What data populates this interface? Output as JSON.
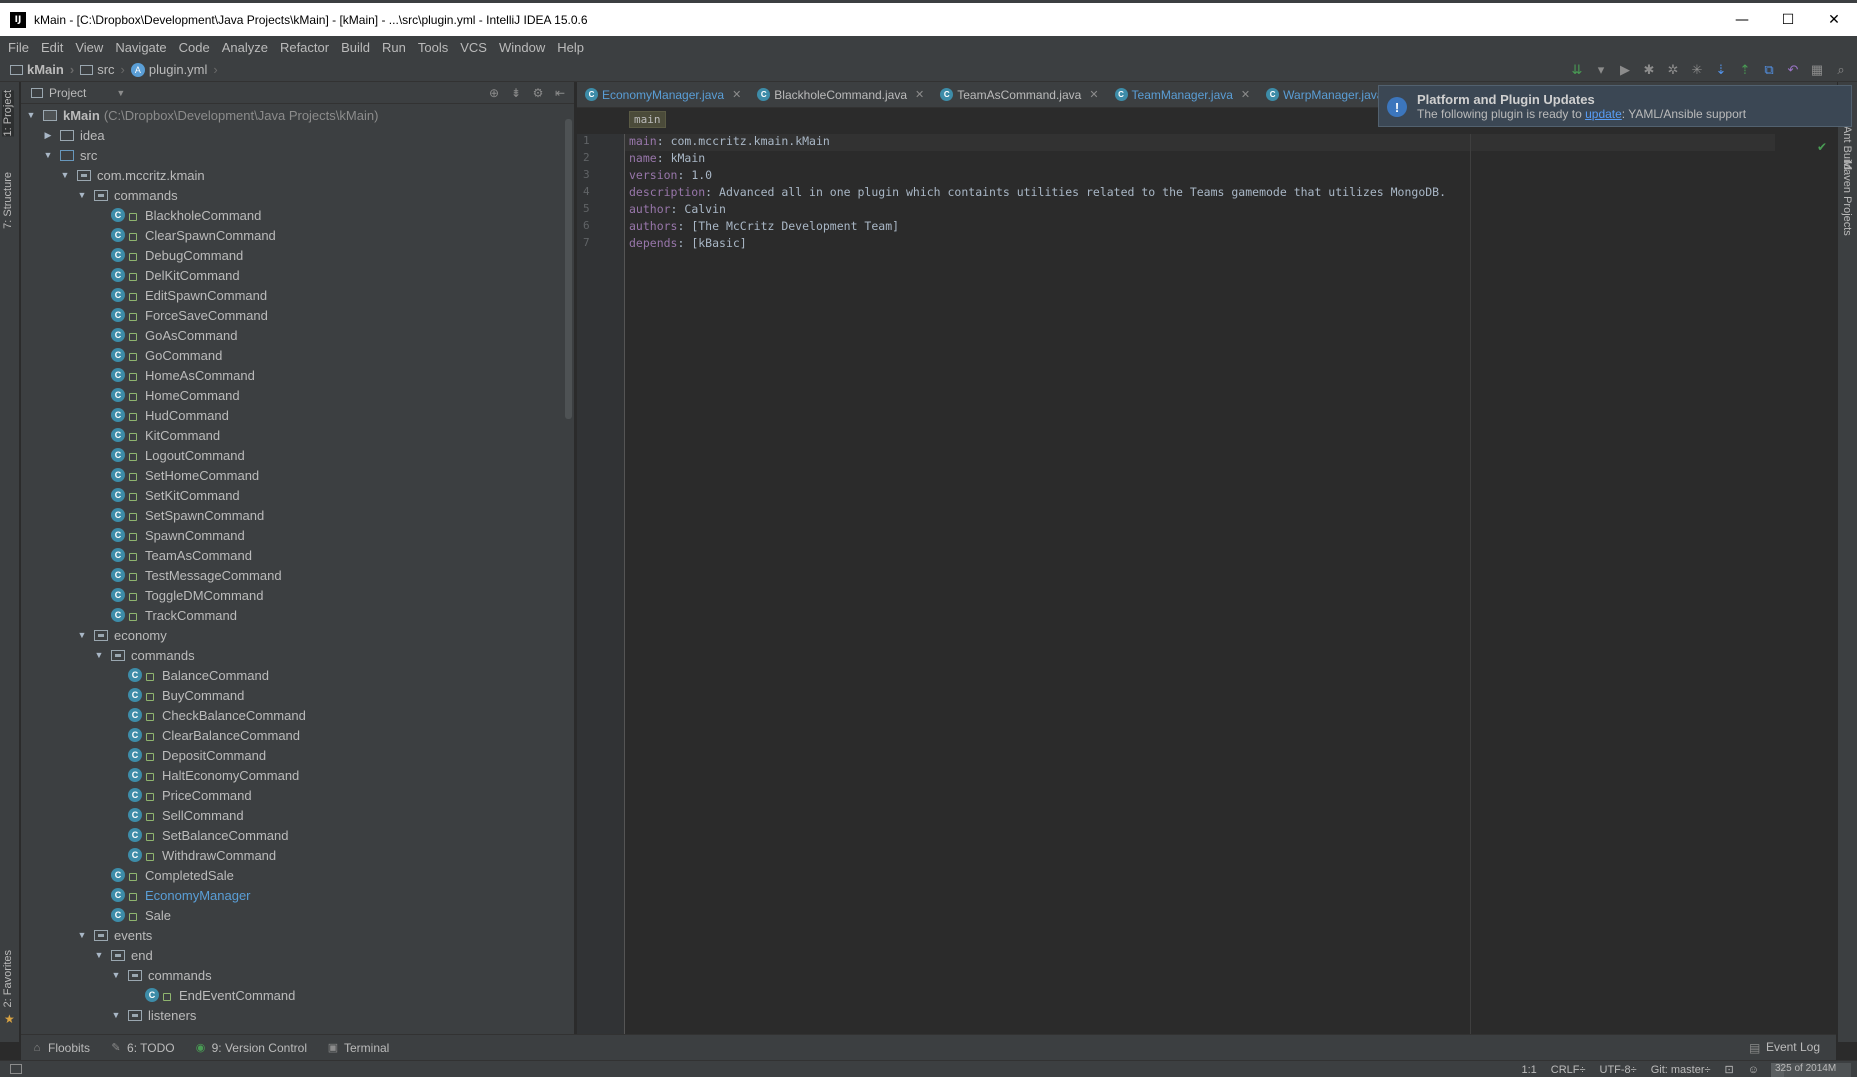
{
  "window": {
    "title": "kMain - [C:\\Dropbox\\Development\\Java Projects\\kMain] - [kMain] - ...\\src\\plugin.yml - IntelliJ IDEA 15.0.6",
    "app_icon": "IJ",
    "minimize": "—",
    "maximize": "☐",
    "close": "✕"
  },
  "menu": [
    "File",
    "Edit",
    "View",
    "Navigate",
    "Code",
    "Analyze",
    "Refactor",
    "Build",
    "Run",
    "Tools",
    "VCS",
    "Window",
    "Help"
  ],
  "navbar": {
    "crumbs": [
      "kMain",
      "src",
      "plugin.yml"
    ]
  },
  "left_strip": {
    "project_tab": "1: Project",
    "structure_tab": "7: Structure",
    "favorites_tab": "2: Favorites"
  },
  "right_strip": {
    "build_tab": "Ant Build",
    "maven_tab": "Maven Projects"
  },
  "project_panel": {
    "header": "Project",
    "root_label": "kMain",
    "root_path": "(C:\\Dropbox\\Development\\Java Projects\\kMain)",
    "items": [
      {
        "depth": 1,
        "type": "folder",
        "label": "idea",
        "expanded": false
      },
      {
        "depth": 1,
        "type": "src",
        "label": "src",
        "expanded": true
      },
      {
        "depth": 2,
        "type": "pkg",
        "label": "com.mccritz.kmain",
        "expanded": true
      },
      {
        "depth": 3,
        "type": "pkg",
        "label": "commands",
        "expanded": true
      },
      {
        "depth": 4,
        "type": "class",
        "label": "BlackholeCommand"
      },
      {
        "depth": 4,
        "type": "class",
        "label": "ClearSpawnCommand"
      },
      {
        "depth": 4,
        "type": "class",
        "label": "DebugCommand"
      },
      {
        "depth": 4,
        "type": "class",
        "label": "DelKitCommand"
      },
      {
        "depth": 4,
        "type": "class",
        "label": "EditSpawnCommand"
      },
      {
        "depth": 4,
        "type": "class",
        "label": "ForceSaveCommand"
      },
      {
        "depth": 4,
        "type": "class",
        "label": "GoAsCommand"
      },
      {
        "depth": 4,
        "type": "class",
        "label": "GoCommand"
      },
      {
        "depth": 4,
        "type": "class",
        "label": "HomeAsCommand"
      },
      {
        "depth": 4,
        "type": "class",
        "label": "HomeCommand"
      },
      {
        "depth": 4,
        "type": "class",
        "label": "HudCommand"
      },
      {
        "depth": 4,
        "type": "class",
        "label": "KitCommand"
      },
      {
        "depth": 4,
        "type": "class",
        "label": "LogoutCommand"
      },
      {
        "depth": 4,
        "type": "class",
        "label": "SetHomeCommand"
      },
      {
        "depth": 4,
        "type": "class",
        "label": "SetKitCommand"
      },
      {
        "depth": 4,
        "type": "class",
        "label": "SetSpawnCommand"
      },
      {
        "depth": 4,
        "type": "class",
        "label": "SpawnCommand"
      },
      {
        "depth": 4,
        "type": "class",
        "label": "TeamAsCommand"
      },
      {
        "depth": 4,
        "type": "class",
        "label": "TestMessageCommand"
      },
      {
        "depth": 4,
        "type": "class",
        "label": "ToggleDMCommand"
      },
      {
        "depth": 4,
        "type": "class",
        "label": "TrackCommand"
      },
      {
        "depth": 3,
        "type": "pkg",
        "label": "economy",
        "expanded": true
      },
      {
        "depth": 4,
        "type": "pkg",
        "label": "commands",
        "expanded": true
      },
      {
        "depth": 5,
        "type": "class",
        "label": "BalanceCommand"
      },
      {
        "depth": 5,
        "type": "class",
        "label": "BuyCommand"
      },
      {
        "depth": 5,
        "type": "class",
        "label": "CheckBalanceCommand"
      },
      {
        "depth": 5,
        "type": "class",
        "label": "ClearBalanceCommand"
      },
      {
        "depth": 5,
        "type": "class",
        "label": "DepositCommand"
      },
      {
        "depth": 5,
        "type": "class",
        "label": "HaltEconomyCommand"
      },
      {
        "depth": 5,
        "type": "class",
        "label": "PriceCommand"
      },
      {
        "depth": 5,
        "type": "class",
        "label": "SellCommand"
      },
      {
        "depth": 5,
        "type": "class",
        "label": "SetBalanceCommand"
      },
      {
        "depth": 5,
        "type": "class",
        "label": "WithdrawCommand"
      },
      {
        "depth": 4,
        "type": "class",
        "label": "CompletedSale"
      },
      {
        "depth": 4,
        "type": "class",
        "label": "EconomyManager",
        "highlight": true
      },
      {
        "depth": 4,
        "type": "class",
        "label": "Sale"
      },
      {
        "depth": 3,
        "type": "pkg",
        "label": "events",
        "expanded": true
      },
      {
        "depth": 4,
        "type": "pkg",
        "label": "end",
        "expanded": true
      },
      {
        "depth": 5,
        "type": "pkg",
        "label": "commands",
        "expanded": true
      },
      {
        "depth": 6,
        "type": "class",
        "label": "EndEventCommand"
      },
      {
        "depth": 5,
        "type": "pkg",
        "label": "listeners",
        "expanded": true
      }
    ]
  },
  "editor": {
    "tabs": [
      {
        "label": "EconomyManager.java",
        "highlight": true
      },
      {
        "label": "BlackholeCommand.java",
        "highlight": false
      },
      {
        "label": "TeamAsCommand.java",
        "highlight": false
      },
      {
        "label": "TeamManager.java",
        "highlight": true
      },
      {
        "label": "WarpManager.java",
        "highlight": true
      }
    ],
    "breadcrumb": "main",
    "lines": [
      {
        "no": "1",
        "key": "main",
        "value": " com.mccritz.kmain.kMain"
      },
      {
        "no": "2",
        "key": "name",
        "value": " kMain"
      },
      {
        "no": "3",
        "key": "version",
        "value": " 1.0"
      },
      {
        "no": "4",
        "key": "description",
        "value": " Advanced all in one plugin which containts utilities related to the Teams gamemode that utilizes MongoDB."
      },
      {
        "no": "5",
        "key": "author",
        "value": " Calvin"
      },
      {
        "no": "6",
        "key": "authors",
        "value": " [The McCritz Development Team]"
      },
      {
        "no": "7",
        "key": "depends",
        "value": " [kBasic]"
      }
    ]
  },
  "notification": {
    "title": "Platform and Plugin Updates",
    "message_prefix": "The following plugin is ready to ",
    "link": "update",
    "message_suffix": ": YAML/Ansible support"
  },
  "bottom_bar": {
    "items": [
      "Floobits",
      "6: TODO",
      "9: Version Control",
      "Terminal"
    ],
    "event_log": "Event Log"
  },
  "status": {
    "position": "1:1",
    "line_sep": "CRLF÷",
    "encoding": "UTF-8÷",
    "git": "Git: master÷",
    "memory": "325 of 2014M",
    "memory_fraction": 0.16
  }
}
